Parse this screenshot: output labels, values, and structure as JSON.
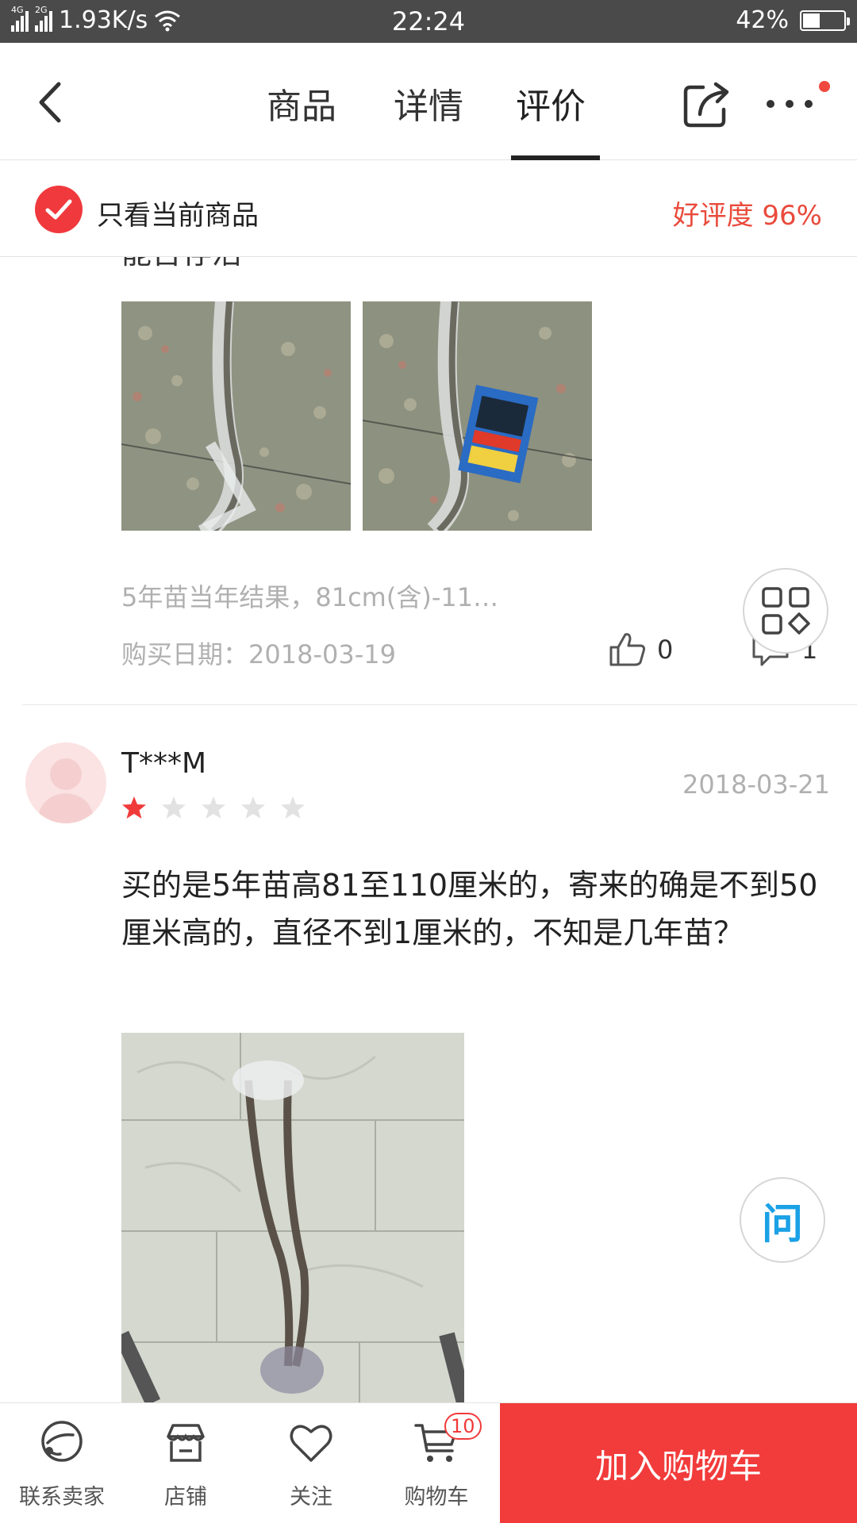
{
  "status_bar": {
    "network_4g": "4G",
    "network_2g": "2G",
    "speed": "1.93K/s",
    "time": "22:24",
    "battery": "42%",
    "battery_level": 0.42
  },
  "header": {
    "tabs": [
      {
        "label": "商品"
      },
      {
        "label": "详情"
      },
      {
        "label": "评价"
      }
    ],
    "active_tab": "评价"
  },
  "filter": {
    "label": "只看当前商品",
    "rating_text": "好评度 96%"
  },
  "review_prev": {
    "cut_text": "能否存活",
    "spec": "5年苗当年结果，81cm(含)-11…",
    "purchase_date": "购买日期：2018-03-19",
    "likes": "0",
    "replies": "1"
  },
  "review": {
    "username": "T***M",
    "rating": 1,
    "rating_max": 5,
    "date": "2018-03-21",
    "text": "买的是5年苗高81至110厘米的，寄来的确是不到50厘米高的，直径不到1厘米的，不知是几年苗？"
  },
  "floating": {
    "ask_label": "问"
  },
  "bottom_bar": {
    "contact_label": "联系卖家",
    "shop_label": "店铺",
    "follow_label": "关注",
    "cart_label": "购物车",
    "cart_count": "10",
    "add_to_cart_label": "加入购物车"
  },
  "colors": {
    "accent_red": "#f23b3b",
    "rating_red": "#e94b3c",
    "ask_blue": "#1aa1e6"
  }
}
